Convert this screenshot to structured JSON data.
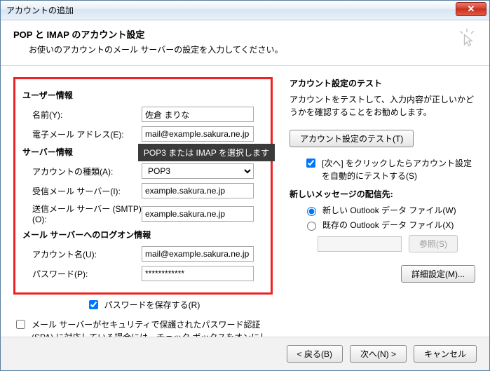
{
  "window": {
    "title": "アカウントの追加"
  },
  "header": {
    "title": "POP と IMAP のアカウント設定",
    "subtitle": "お使いのアカウントのメール サーバーの設定を入力してください。"
  },
  "sections": {
    "user": {
      "head": "ユーザー情報",
      "name_label": "名前(Y):",
      "name_value": "佐倉 まりな",
      "email_label": "電子メール アドレス(E):",
      "email_value": "mail@example.sakura.ne.jp"
    },
    "server": {
      "head": "サーバー情報",
      "tooltip": "POP3 または IMAP を選択します",
      "type_label": "アカウントの種類(A):",
      "type_value": "POP3",
      "incoming_label": "受信メール サーバー(I):",
      "incoming_value": "example.sakura.ne.jp",
      "outgoing_label": "送信メール サーバー (SMTP)(O):",
      "outgoing_value": "example.sakura.ne.jp"
    },
    "logon": {
      "head": "メール サーバーへのログオン情報",
      "user_label": "アカウント名(U):",
      "user_value": "mail@example.sakura.ne.jp",
      "pass_label": "パスワード(P):",
      "pass_value": "************"
    },
    "remember": "パスワードを保存する(R)",
    "spa": "メール サーバーがセキュリティで保護されたパスワード認証 (SPA) に対応している場合には、チェック ボックスをオンにしてください(Q)"
  },
  "right": {
    "test_head": "アカウント設定のテスト",
    "test_desc": "アカウントをテストして、入力内容が正しいかどうかを確認することをお勧めします。",
    "test_btn": "アカウント設定のテスト(T)",
    "auto_test": "[次へ] をクリックしたらアカウント設定を自動的にテストする(S)",
    "deliver_head": "新しいメッセージの配信先:",
    "radio_new": "新しい Outlook データ ファイル(W)",
    "radio_existing": "既存の Outlook データ ファイル(X)",
    "browse": "参照(S)",
    "advanced": "詳細設定(M)..."
  },
  "footer": {
    "back": "< 戻る(B)",
    "next": "次へ(N) >",
    "cancel": "キャンセル"
  }
}
